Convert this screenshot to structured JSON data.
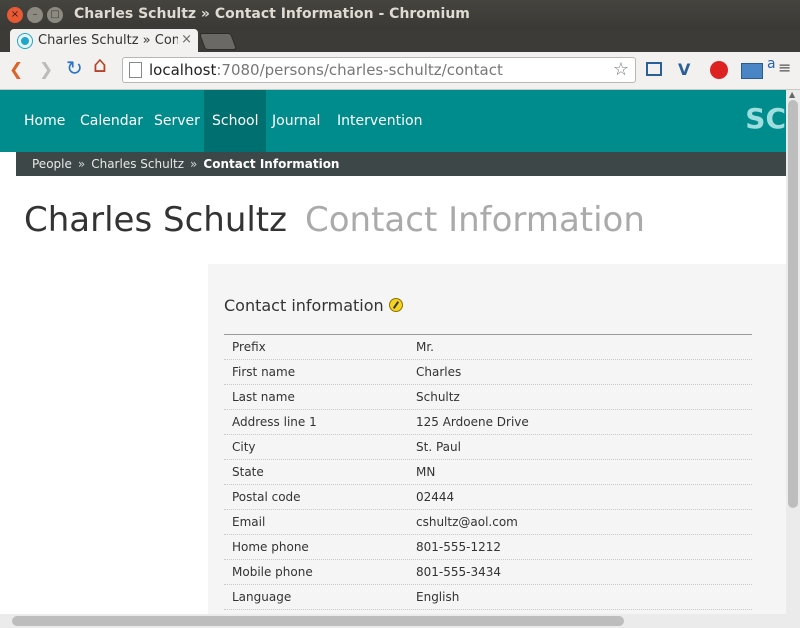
{
  "window": {
    "title": "Charles Schultz » Contact Information - Chromium"
  },
  "tab": {
    "title": "Charles Schultz » Contact Information",
    "close": "×"
  },
  "toolbar": {
    "url_host": "localhost",
    "url_path": ":7080/persons/charles-schultz/contact",
    "back": "❮",
    "forward": "❯",
    "reload": "↻",
    "home": "⌂",
    "star": "☆"
  },
  "nav": {
    "items": [
      "Home",
      "Calendar",
      "Server",
      "School",
      "Journal",
      "Intervention"
    ],
    "active": "School",
    "brand_partial": "SC"
  },
  "breadcrumb": {
    "items": [
      "People",
      "Charles Schultz"
    ],
    "separator": "»",
    "current": "Contact Information"
  },
  "page": {
    "name": "Charles Schultz",
    "subtitle": "Contact Information"
  },
  "section": {
    "title": "Contact information"
  },
  "contact": [
    {
      "label": "Prefix",
      "value": "Mr."
    },
    {
      "label": "First name",
      "value": "Charles"
    },
    {
      "label": "Last name",
      "value": "Schultz"
    },
    {
      "label": "Address line 1",
      "value": "125 Ardoene Drive"
    },
    {
      "label": "City",
      "value": "St. Paul"
    },
    {
      "label": "State",
      "value": "MN"
    },
    {
      "label": "Postal code",
      "value": "02444"
    },
    {
      "label": "Email",
      "value": "cshultz@aol.com"
    },
    {
      "label": "Home phone",
      "value": "801-555-1212"
    },
    {
      "label": "Mobile phone",
      "value": "801-555-3434"
    },
    {
      "label": "Language",
      "value": "English"
    }
  ],
  "colors": {
    "nav": "#008c8c",
    "nav_active": "#006f6f",
    "crumbbar": "#3e4747"
  }
}
